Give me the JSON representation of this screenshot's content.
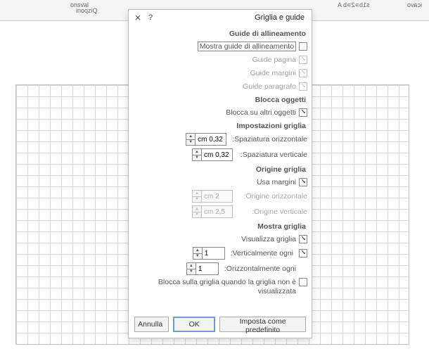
{
  "ribbon": {
    "item1": "onsval",
    "item2": "inoqziQ",
    "item3": "s1b∍2∍b A",
    "item4": "icavo"
  },
  "dialog": {
    "title": "Griglia e guide",
    "help": "?",
    "close": "✕"
  },
  "sections": {
    "alignment_guides": "Guide di allineamento",
    "lock_objects": "Blocca oggetti",
    "grid_settings": "Impostazioni griglia",
    "grid_origin": "Origine griglia",
    "show_grid": "Mostra griglia"
  },
  "options": {
    "show_alignment_guides": "Mostra guide di allineamento",
    "page_guides": "Guide pagina",
    "margin_guides": "Guide margini",
    "paragraph_guides": "Guide paragrafo",
    "lock_on_other_objects": "Blocca su altri oggetti",
    "horizontal_spacing": "Spaziatura orizzontale:",
    "vertical_spacing": "Spaziatura verticale:",
    "use_margins": "Usa margini",
    "horizontal_origin": "Origine orizzontale:",
    "vertical_origin": "Origine verticale:",
    "visualize_grid": "Visualizza griglia",
    "vertically_every": "Verticalmente ogni:",
    "horizontally_every": "Orizzontalmente ogni:",
    "lock_on_grid_when_not_visible": "Blocca sulla griglia quando la griglia non è visualizzata"
  },
  "values": {
    "h_spacing": "0,32 cm",
    "v_spacing": "0,32 cm",
    "h_origin": "2 cm",
    "v_origin": "2,5 cm",
    "vert_every": "1",
    "horiz_every": "1"
  },
  "buttons": {
    "set_default": "Imposta come predefinito",
    "ok": "OK",
    "cancel": "Annulla"
  }
}
